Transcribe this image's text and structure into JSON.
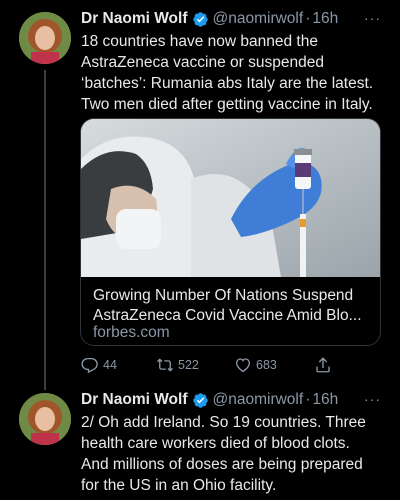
{
  "tweets": [
    {
      "author_name": "Dr Naomi Wolf",
      "handle": "@naomirwolf",
      "separator": "·",
      "time": "16h",
      "more": "···",
      "text": "18 countries have now banned the\nAstraZeneca vaccine or suspended\n‘batches’: Rumania abs Italy are the latest.\nTwo men died after getting vaccine in Italy.",
      "card": {
        "title": "Growing Number Of Nations Suspend\nAstraZeneca Covid Vaccine Amid Blo...",
        "domain": "forbes.com"
      },
      "actions": {
        "replies": "44",
        "retweets": "522",
        "likes": "683"
      }
    },
    {
      "author_name": "Dr Naomi Wolf",
      "handle": "@naomirwolf",
      "separator": "·",
      "time": "16h",
      "more": "···",
      "text": "2/ Oh add Ireland. So 19 countries. Three\nhealth care workers died of blood clots.\nAnd millions of doses are being prepared\nfor the US in an Ohio facility."
    }
  ],
  "icons": {
    "verified": "verified-badge-icon",
    "reply": "reply-icon",
    "retweet": "retweet-icon",
    "like": "heart-icon",
    "share": "share-icon"
  },
  "colors": {
    "background": "#000000",
    "text": "#e7e9ea",
    "secondary": "#8b98a5",
    "verified": "#1d9bf0",
    "border": "#2f3336"
  }
}
